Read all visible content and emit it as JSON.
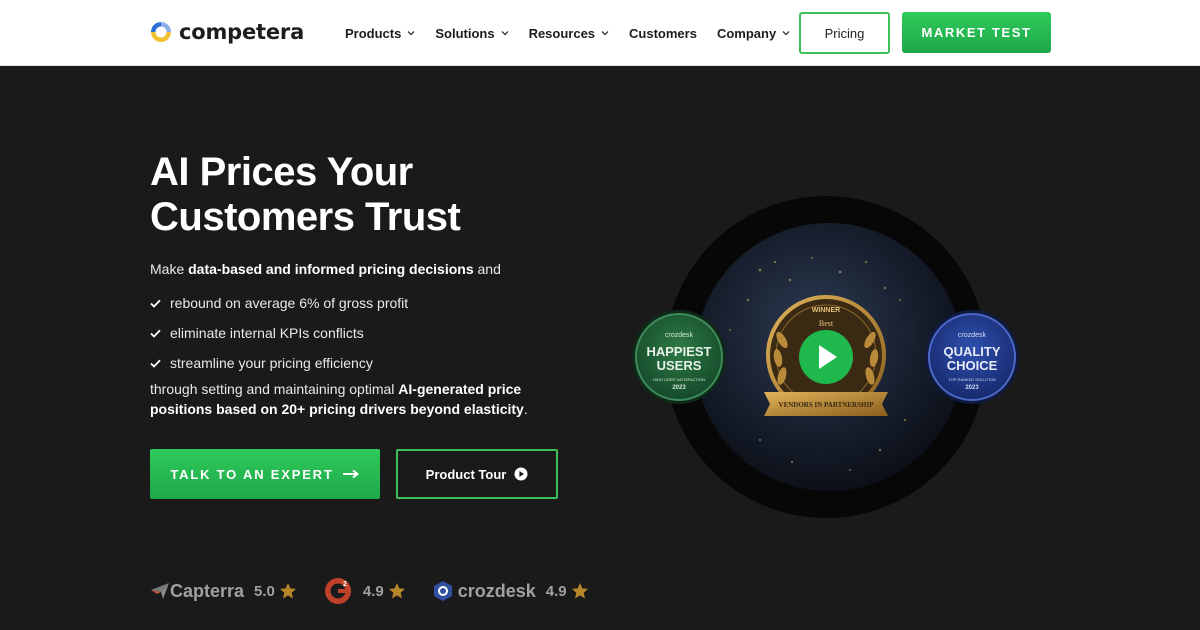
{
  "brand": {
    "name": "competera",
    "colors": {
      "blue": "#2b6fd6",
      "yellow": "#f2c230",
      "green": "#2fca5a"
    }
  },
  "nav": {
    "items": [
      {
        "label": "Products",
        "has_dropdown": true
      },
      {
        "label": "Solutions",
        "has_dropdown": true
      },
      {
        "label": "Resources",
        "has_dropdown": true
      },
      {
        "label": "Customers",
        "has_dropdown": false
      },
      {
        "label": "Company",
        "has_dropdown": true
      }
    ],
    "pricing_label": "Pricing",
    "market_test_label": "MARKET TEST"
  },
  "hero": {
    "title": "AI Prices Your Customers Trust",
    "intro_prefix": "Make ",
    "intro_bold": "data-based and informed pricing decisions",
    "intro_suffix": " and",
    "bullets": [
      "rebound on average 6% of gross profit",
      "eliminate internal KPIs conflicts",
      "streamline your pricing efficiency"
    ],
    "outro_prefix": "through setting and maintaining optimal ",
    "outro_bold": "AI-generated price positions based on 20+ pricing drivers beyond elasticity",
    "outro_suffix": ".",
    "cta_primary": "TALK TO AN EXPERT",
    "cta_secondary": "Product Tour"
  },
  "ratings": [
    {
      "brand": "Capterra",
      "score": "5.0",
      "icon": "capterra-logo"
    },
    {
      "brand": "G2",
      "score": "4.9",
      "icon": "g2-logo"
    },
    {
      "brand": "crozdesk",
      "score": "4.9",
      "icon": "crozdesk-logo"
    }
  ],
  "badges": {
    "left": {
      "top": "crozdesk",
      "line1": "HAPPIEST",
      "line2": "USERS",
      "sub": "HIGH USER SATISFACTION",
      "year": "2023"
    },
    "center": {
      "top": "WINNER",
      "sub": "Best",
      "ribbon": "VENDORS IN PARTNERSHIP"
    },
    "right": {
      "top": "crozdesk",
      "line1": "QUALITY",
      "line2": "CHOICE",
      "sub": "TOP RANKED SOLUTION",
      "year": "2023"
    }
  }
}
